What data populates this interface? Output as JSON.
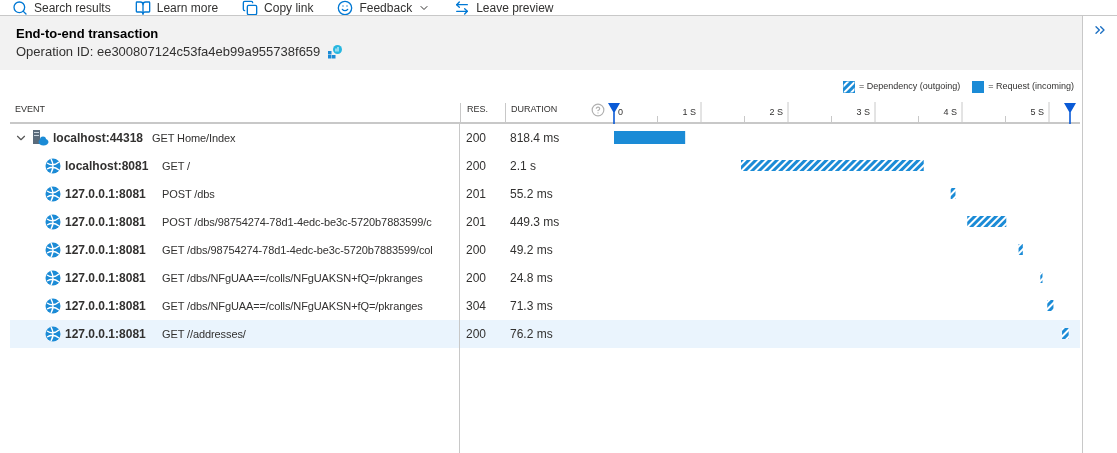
{
  "toolbar": [
    {
      "label": "Search results",
      "kind": "search"
    },
    {
      "label": "Learn more",
      "kind": "learn"
    },
    {
      "label": "Copy link",
      "kind": "copy"
    },
    {
      "label": "Feedback",
      "kind": "feedback"
    },
    {
      "label": "Leave preview",
      "kind": "leave"
    }
  ],
  "header": {
    "title": "End-to-end transaction",
    "operation_id": "Operation ID: ee300807124c53fa4eb99a955738f659"
  },
  "legend": [
    {
      "label": "= Dependency (outgoing)",
      "kind": "dependency"
    },
    {
      "label": "= Request (incoming)",
      "kind": "request"
    }
  ],
  "table": {
    "columns": [
      "EVENT",
      "RES.",
      "DURATION"
    ],
    "rows": [
      {
        "kind": "request",
        "expanded": true,
        "selected": false,
        "host": "localhost:44318",
        "operation": "GET Home/Index",
        "result": "200",
        "duration": "818.4 ms",
        "children": [
          {
            "kind": "dependency",
            "selected": false,
            "host": "localhost:8081",
            "operation": "GET /",
            "result": "200",
            "duration": "2.1 s"
          },
          {
            "kind": "dependency",
            "selected": false,
            "host": "127.0.0.1:8081",
            "operation": "POST /dbs",
            "result": "201",
            "duration": "55.2 ms"
          },
          {
            "kind": "dependency",
            "selected": false,
            "host": "127.0.0.1:8081",
            "operation": "POST /dbs/98754274-78d1-4edc-be3c-5720b7883599/c",
            "result": "201",
            "duration": "449.3 ms"
          },
          {
            "kind": "dependency",
            "selected": false,
            "host": "127.0.0.1:8081",
            "operation": "GET /dbs/98754274-78d1-4edc-be3c-5720b7883599/col",
            "result": "200",
            "duration": "49.2 ms"
          },
          {
            "kind": "dependency",
            "selected": false,
            "host": "127.0.0.1:8081",
            "operation": "GET /dbs/NFgUAA==/colls/NFgUAKSN+fQ=/pkranges",
            "result": "200",
            "duration": "24.8 ms"
          },
          {
            "kind": "dependency",
            "selected": false,
            "host": "127.0.0.1:8081",
            "operation": "GET /dbs/NFgUAA==/colls/NFgUAKSN+fQ=/pkranges",
            "result": "304",
            "duration": "71.3 ms"
          },
          {
            "kind": "dependency",
            "selected": true,
            "host": "127.0.0.1:8081",
            "operation": "GET //addresses/",
            "result": "200",
            "duration": "76.2 ms"
          }
        ]
      }
    ],
    "timeline_ticks": [
      "0",
      "1 S",
      "2 S",
      "3 S",
      "4 S",
      "5 S"
    ]
  }
}
